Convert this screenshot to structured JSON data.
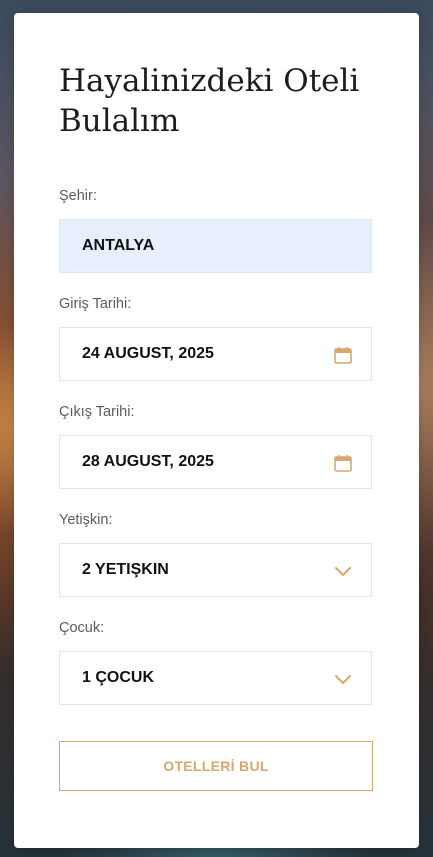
{
  "form": {
    "title": "Hayalinizdeki Oteli Bulalım",
    "city": {
      "label": "Şehir:",
      "value": "ANTALYA"
    },
    "checkin": {
      "label": "Giriş Tarihi:",
      "value": "24 AUGUST, 2025",
      "icon": "calendar-icon"
    },
    "checkout": {
      "label": "Çıkış Tarihi:",
      "value": "28 AUGUST, 2025",
      "icon": "calendar-icon"
    },
    "adults": {
      "label": "Yetişkin:",
      "value": "2 YETIŞKIN",
      "icon": "chevron-down-icon"
    },
    "children": {
      "label": "Çocuk:",
      "value": "1 ÇOCUK",
      "icon": "chevron-down-icon"
    },
    "submit_label": "OTELLERİ BUL"
  },
  "colors": {
    "accent": "#d9a66e",
    "highlight_field": "#e8effc"
  }
}
